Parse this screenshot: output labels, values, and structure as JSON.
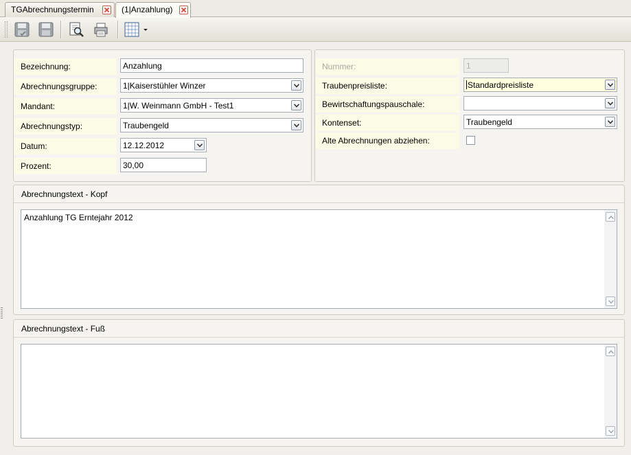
{
  "tabs": [
    {
      "label": "TGAbrechnungstermin"
    },
    {
      "label": "(1|Anzahlung)"
    }
  ],
  "icons": {
    "save": "save-icon",
    "save_close": "save-disk-icon",
    "preview": "print-preview-icon",
    "print": "printer-icon",
    "grid": "grid-layout-icon"
  },
  "left": {
    "bezeichnung": {
      "label": "Bezeichnung:",
      "value": "Anzahlung"
    },
    "gruppe": {
      "label": "Abrechnungsgruppe:",
      "value": "1|Kaiserstühler Winzer"
    },
    "mandant": {
      "label": "Mandant:",
      "value": "1|W. Weinmann GmbH - Test1"
    },
    "typ": {
      "label": "Abrechnungstyp:",
      "value": "Traubengeld"
    },
    "datum": {
      "label": "Datum:",
      "value": "12.12.2012"
    },
    "prozent": {
      "label": "Prozent:",
      "value": "30,00"
    }
  },
  "right": {
    "nummer": {
      "label": "Nummer:",
      "value": "1"
    },
    "preisliste": {
      "label": "Traubenpreisliste:",
      "value": "Standardpreisliste"
    },
    "pauschale": {
      "label": "Bewirtschaftungspauschale:",
      "value": ""
    },
    "kontenset": {
      "label": "Kontenset:",
      "value": "Traubengeld"
    },
    "alte": {
      "label": "Alte Abrechnungen abziehen:",
      "checked": false
    }
  },
  "kopf": {
    "title": "Abrechnungstext - Kopf",
    "text": "Anzahlung TG Erntejahr 2012"
  },
  "fuss": {
    "title": "Abrechnungstext - Fuß",
    "text": ""
  }
}
